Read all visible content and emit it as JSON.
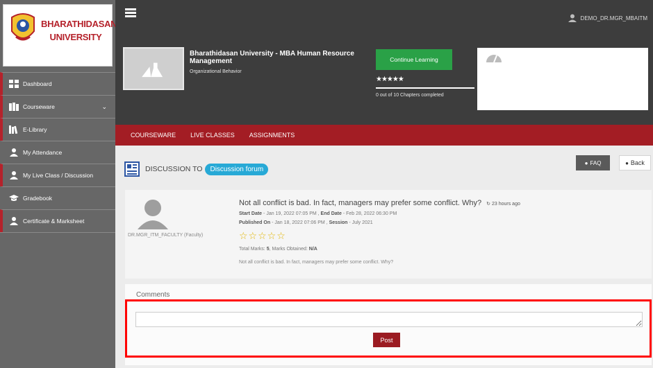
{
  "brand": {
    "logo_line1": "BHARATHIDASAN",
    "logo_line2": "UNIVERSITY"
  },
  "sidebar": {
    "items": [
      {
        "label": "Dashboard",
        "icon": "grid-icon"
      },
      {
        "label": "Courseware",
        "icon": "books-icon",
        "chevron": "⌄"
      },
      {
        "label": "E-Library",
        "icon": "library-icon"
      },
      {
        "label": "My Attendance",
        "icon": "user-icon"
      },
      {
        "label": "My Live Class / Discussion",
        "icon": "user-icon"
      },
      {
        "label": "Gradebook",
        "icon": "graduation-cap-icon"
      },
      {
        "label": "Certificate & Marksheet",
        "icon": "user-icon"
      }
    ]
  },
  "topbar": {
    "username": "DEMO_DR.MGR_MBAITM"
  },
  "course": {
    "title": "Bharathidasan University - MBA Human Resource Management",
    "subtitle": "Organizational Behavior",
    "continue_label": "Continue Learning",
    "stars": "★★★★★",
    "progress_text": "0 out of 10 Chapters completed"
  },
  "tabs": [
    "COURSEWARE",
    "LIVE CLASSES",
    "ASSIGNMENTS"
  ],
  "discussion": {
    "heading": "DISCUSSION TO",
    "forum_pill": "Discussion forum",
    "faq_label": "FAQ",
    "back_label": "Back"
  },
  "post": {
    "author": "DR.MGR_ITM_FACULTY (Faculty)",
    "title": "Not all conflict is bad. In fact, managers may prefer some conflict. Why?",
    "time_ago": "23 hours ago",
    "start_date_label": "Start Date",
    "start_date": "Jan 19, 2022 07:05 PM",
    "end_date_label": "End Date",
    "end_date": "Feb 28, 2022 06:30 PM",
    "published_label": "Published On",
    "published": "Jan 18, 2022 07:06 PM",
    "session_label": "Session",
    "session": "July 2021",
    "rating_stars": "☆☆☆☆☆",
    "total_marks_label": "Total Marks",
    "total_marks": "5",
    "marks_obtained_label": "Marks Obtained",
    "marks_obtained": "N/A",
    "body": "Not all conflict is bad. In fact, managers may prefer some conflict. Why?"
  },
  "comments": {
    "label": "Comments",
    "value": "",
    "post_label": "Post"
  },
  "colors": {
    "sidebar_bg": "#676767",
    "header_bg": "#3d3d3d",
    "tab_bar": "#a31d24",
    "accent_green": "#2aa147",
    "pill_blue": "#27a9d6",
    "highlight_red": "#ff0000"
  }
}
